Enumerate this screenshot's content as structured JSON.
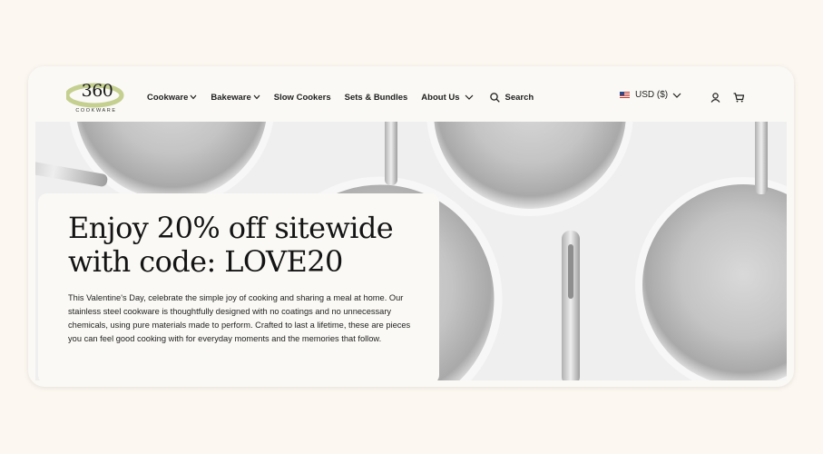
{
  "brand": {
    "logo_number": "360",
    "logo_subtitle": "COOKWARE",
    "accent": "#c5cf8f"
  },
  "nav": {
    "items": [
      {
        "label": "Cookware",
        "has_dropdown": true
      },
      {
        "label": "Bakeware",
        "has_dropdown": true
      },
      {
        "label": "Slow Cookers",
        "has_dropdown": false
      },
      {
        "label": "Sets & Bundles",
        "has_dropdown": false
      },
      {
        "label": "About Us",
        "has_dropdown": true
      }
    ],
    "search_label": "Search"
  },
  "header_right": {
    "currency": "USD ($)",
    "account_icon": "user-icon",
    "cart_icon": "cart-icon"
  },
  "promo": {
    "title_line1": "Enjoy 20% off sitewide",
    "title_line2": "with code: LOVE20",
    "body": "This Valentine's Day, celebrate the simple joy of cooking and sharing a meal at home. Our stainless steel cookware is thoughtfully designed with no coatings and no unnecessary chemicals, using pure materials made to perform. Crafted to last a lifetime, these are pieces you can feel good cooking with for everyday moments and the memories that follow."
  },
  "colors": {
    "page_bg": "#fcf8f1",
    "card_bg": "#faf9f5",
    "text": "#1e1e1e"
  }
}
